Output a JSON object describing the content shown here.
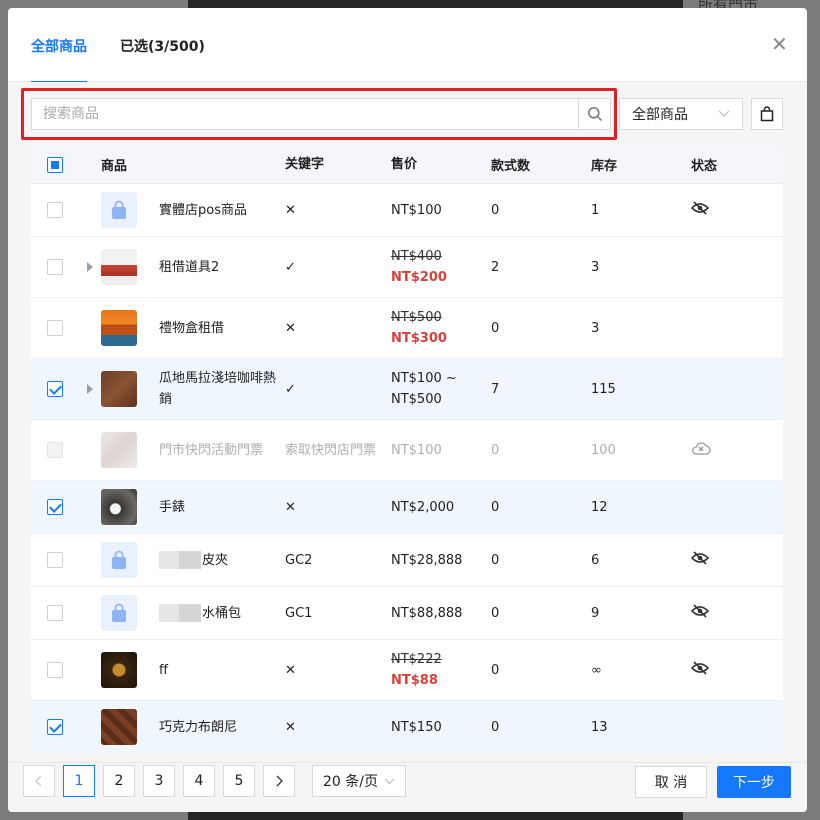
{
  "background": {
    "right_text": "所有門市"
  },
  "modal": {
    "tabs": [
      {
        "label": "全部商品"
      },
      {
        "label": "已选(3/500)"
      }
    ],
    "search": {
      "placeholder": "搜索商品",
      "value": ""
    },
    "filter": {
      "selected": "全部商品"
    },
    "table": {
      "headers": {
        "product": "商品",
        "keyword": "关键字",
        "price": "售价",
        "variants": "款式数",
        "stock": "库存",
        "status": "状态"
      },
      "rows": [
        {
          "name": "實體店pos商品",
          "keyword": "✕",
          "price": "NT$100",
          "price2": "",
          "variants": "0",
          "stock": "1",
          "status_icon": "eye-off-icon",
          "checked": false,
          "expand": false,
          "thumb": "placeholder-bag-icon"
        },
        {
          "name": "租借道具2",
          "keyword": "✓",
          "price": "NT$400",
          "price2": "NT$200",
          "variants": "2",
          "stock": "3",
          "status_icon": "",
          "checked": false,
          "expand": true,
          "thumb": "photo"
        },
        {
          "name": "禮物盒租借",
          "keyword": "✕",
          "price": "NT$500",
          "price2": "NT$300",
          "variants": "0",
          "stock": "3",
          "status_icon": "",
          "checked": false,
          "expand": false,
          "thumb": "photo"
        },
        {
          "name": "瓜地馬拉淺培咖啡熱銷",
          "keyword": "✓",
          "price": "NT$100 ~",
          "price2": "NT$500",
          "variants": "7",
          "stock": "115",
          "status_icon": "",
          "checked": true,
          "expand": true,
          "thumb": "photo"
        },
        {
          "name": "門市快閃活動門票",
          "keyword": "索取快閃店門票",
          "price": "NT$100",
          "price2": "",
          "variants": "0",
          "stock": "100",
          "status_icon": "cloud-off-icon",
          "checked": false,
          "expand": false,
          "thumb": "photo",
          "disabled": true
        },
        {
          "name": "手錶",
          "keyword": "✕",
          "price": "NT$2,000",
          "price2": "",
          "variants": "0",
          "stock": "12",
          "status_icon": "",
          "checked": true,
          "expand": false,
          "thumb": "photo"
        },
        {
          "name": "皮夾",
          "keyword": "GC2",
          "price": "NT$28,888",
          "price2": "",
          "variants": "0",
          "stock": "6",
          "status_icon": "eye-off-icon",
          "checked": false,
          "expand": false,
          "thumb": "placeholder-bag-icon"
        },
        {
          "name": "水桶包",
          "keyword": "GC1",
          "price": "NT$88,888",
          "price2": "",
          "variants": "0",
          "stock": "9",
          "status_icon": "eye-off-icon",
          "checked": false,
          "expand": false,
          "thumb": "placeholder-bag-icon"
        },
        {
          "name": "ff",
          "keyword": "✕",
          "price": "NT$222",
          "price2": "NT$88",
          "variants": "0",
          "stock": "∞",
          "status_icon": "eye-off-icon",
          "checked": false,
          "expand": false,
          "thumb": "photo"
        },
        {
          "name": "巧克力布朗尼",
          "keyword": "✕",
          "price": "NT$150",
          "price2": "",
          "variants": "0",
          "stock": "13",
          "status_icon": "",
          "checked": true,
          "expand": false,
          "thumb": "photo"
        }
      ]
    },
    "pagination": {
      "pages": [
        "1",
        "2",
        "3",
        "4",
        "5"
      ],
      "current": "1",
      "page_size": "20 条/页"
    },
    "buttons": {
      "cancel": "取 消",
      "next": "下一步"
    },
    "colors": {
      "accent": "#1677ff",
      "sale": "#d9413b",
      "highlight": "#e02020"
    }
  }
}
